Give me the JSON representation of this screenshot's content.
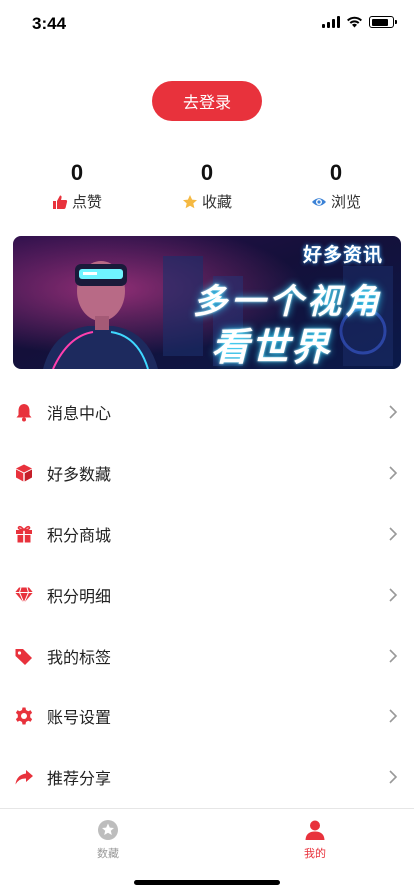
{
  "status_bar": {
    "time": "3:44"
  },
  "login_button": {
    "label": "去登录"
  },
  "stats": [
    {
      "value": "0",
      "label": "点赞",
      "icon": "thumbs-up-icon",
      "color": "#e8323c"
    },
    {
      "value": "0",
      "label": "收藏",
      "icon": "star-icon",
      "color": "#f5b942"
    },
    {
      "value": "0",
      "label": "浏览",
      "icon": "eye-icon",
      "color": "#3b82d6"
    }
  ],
  "banner": {
    "brand": "好多资讯",
    "headline_1": "多一个视角",
    "headline_2": "看世界"
  },
  "menu": [
    {
      "label": "消息中心",
      "icon": "bell-icon"
    },
    {
      "label": "好多数藏",
      "icon": "cube-icon"
    },
    {
      "label": "积分商城",
      "icon": "gift-icon"
    },
    {
      "label": "积分明细",
      "icon": "diamond-icon"
    },
    {
      "label": "我的标签",
      "icon": "tag-icon"
    },
    {
      "label": "账号设置",
      "icon": "gear-icon"
    },
    {
      "label": "推荐分享",
      "icon": "share-icon"
    }
  ],
  "tabbar": [
    {
      "label": "数藏",
      "icon": "star-circle-icon",
      "active": false
    },
    {
      "label": "我的",
      "icon": "user-icon",
      "active": true
    }
  ],
  "colors": {
    "accent": "#e8323c",
    "inactive": "#999999"
  }
}
